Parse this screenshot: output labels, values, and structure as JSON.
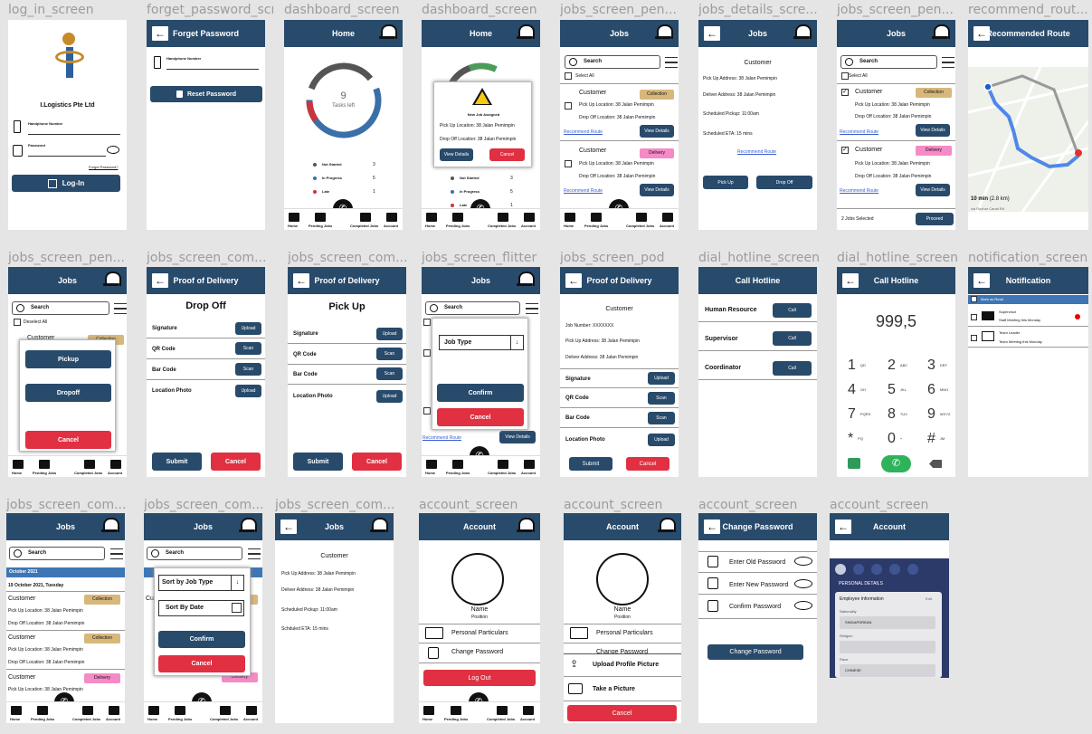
{
  "labels": [
    "log_in_screen",
    "forget_password_scre...",
    "dashboard_screen",
    "dashboard_screen",
    "jobs_screen_pen...",
    "jobs_details_scre...",
    "jobs_screen_pen...",
    "recommend_rout...",
    "jobs_screen_pen...",
    "jobs_screen_com...",
    "jobs_screen_com...",
    "jobs_screen_flitter",
    "jobs_screen_pod",
    "dial_hotline_screen",
    "dial_hotline_screen",
    "notification_screen",
    "jobs_screen_com...",
    "jobs_screen_com...",
    "jobs_screen_com...",
    "account_screen",
    "account_screen",
    "account_screen",
    "account_screen"
  ],
  "login": {
    "company": "I.Logistics Pte Ltd",
    "phone_label": "Handphone Number",
    "password_label": "Password",
    "forgot": "Forget Password?",
    "login_btn": "Log-In"
  },
  "forget": {
    "title": "Forget Password",
    "phone_label": "Handphone Number",
    "reset_btn": "Reset Password"
  },
  "common": {
    "home": "Home",
    "jobs": "Jobs",
    "search": "Search",
    "customer": "Customer",
    "collection": "Collection",
    "delivery": "Delivery",
    "view_details": "View Details",
    "recommend": "Recommend Route",
    "pickup_loc": "Pick Up Location: 38 Jalan Pemimpin",
    "dropoff_loc": "Drop Off Location: 38 Jalan Pemimpin",
    "pickup_addr": "Pick Up Address: 38 Jalan Pemimpin",
    "deliver_addr": "Deliver Address: 38 Jalan Pemimpin",
    "sched_pickup": "Scheduled Pickup: 11:00am",
    "sched_eta": "Scheduled ETA: 15 mins",
    "schd_eta": "Schduled ETA: 15 mins",
    "select_all": "Select All",
    "deselect_all": "Deselect All",
    "proof": "Proof of Delivery",
    "submit": "Submit",
    "cancel": "Cancel",
    "confirm": "Confirm",
    "upload": "Upload",
    "scan": "Scan",
    "signature": "Signature",
    "qr": "QR Code",
    "bar": "Bar Code",
    "photo": "Location Photo"
  },
  "nav": {
    "home": "Home",
    "pending": "Pending Jobs",
    "completed": "Completed Jobs",
    "account": "Account"
  },
  "dashboard": {
    "count": "9",
    "tasks_left": "Tasks left",
    "legend": [
      {
        "label": "Not Started",
        "value": "3",
        "color": "#555555"
      },
      {
        "label": "In Progress",
        "value": "5",
        "color": "#3b6fa8"
      },
      {
        "label": "Late",
        "value": "1",
        "color": "#c8353e"
      }
    ],
    "new_job": "New Job Assigned"
  },
  "details": {
    "pickup_btn": "Pick Up",
    "dropoff_btn": "Drop Off"
  },
  "jobs_sel": {
    "selected": "2 Jobs Selected",
    "proceed": "Proceed"
  },
  "route": {
    "title": "Recommended Route",
    "time": "10 min",
    "dist": "(2.8 km)",
    "via": "via Rochor Canal Rd"
  },
  "pen_modal": {
    "pickup": "Pickup",
    "dropoff": "Dropoff"
  },
  "pod": {
    "drop_off": "Drop Off",
    "pick_up": "Pick Up",
    "job_number": "Job Number: XXXXXXX"
  },
  "filter": {
    "job_type": "Job Type",
    "sort_type": "Sort by Job Type",
    "sort_date": "Sort By Date"
  },
  "hotline": {
    "title": "Call Hotline",
    "items": [
      "Human Resource",
      "Supervisor",
      "Coordinator"
    ],
    "call": "Call",
    "number": "999,5",
    "keys": [
      [
        "1",
        "QD"
      ],
      [
        "2",
        "ABC"
      ],
      [
        "3",
        "DEF"
      ],
      [
        "4",
        "GH"
      ],
      [
        "5",
        "JKL"
      ],
      [
        "6",
        "MNO"
      ],
      [
        "7",
        "PQRS"
      ],
      [
        "8",
        "TUV"
      ],
      [
        "9",
        "WXYZ"
      ],
      [
        "*",
        "PQ"
      ],
      [
        "0",
        "+"
      ],
      [
        "#",
        "JM"
      ]
    ]
  },
  "notif": {
    "title": "Notification",
    "mark": "Mark as Read",
    "items": [
      {
        "from": "Supervisor",
        "msg": "Staff Meeting this Monday"
      },
      {
        "from": "Team Leader",
        "msg": "Team Meeting this Monday"
      }
    ]
  },
  "completed": {
    "month": "October 2021",
    "day": "19 October 2021, Tuesday"
  },
  "account": {
    "title": "Account",
    "name": "Name",
    "position": "Position",
    "personal": "Personal Particulars",
    "change_pw": "Change Password",
    "logout": "Log Out",
    "upload_pic": "Upload Profile Picture",
    "take_pic": "Take a Picture"
  },
  "changepw": {
    "title": "Change Password",
    "old": "Enter Old Password",
    "new": "Enter New Password",
    "confirm": "Confirm Password",
    "btn": "Change Password"
  },
  "acc_photo": {
    "section": "PERSONAL DETAILS",
    "heading": "Employee Information",
    "edit": "Edit",
    "nationality": "Nationality",
    "nat_val": "SINGAPOREAN",
    "religion": "Religion",
    "race": "Race",
    "race_val": "CHINESE"
  }
}
